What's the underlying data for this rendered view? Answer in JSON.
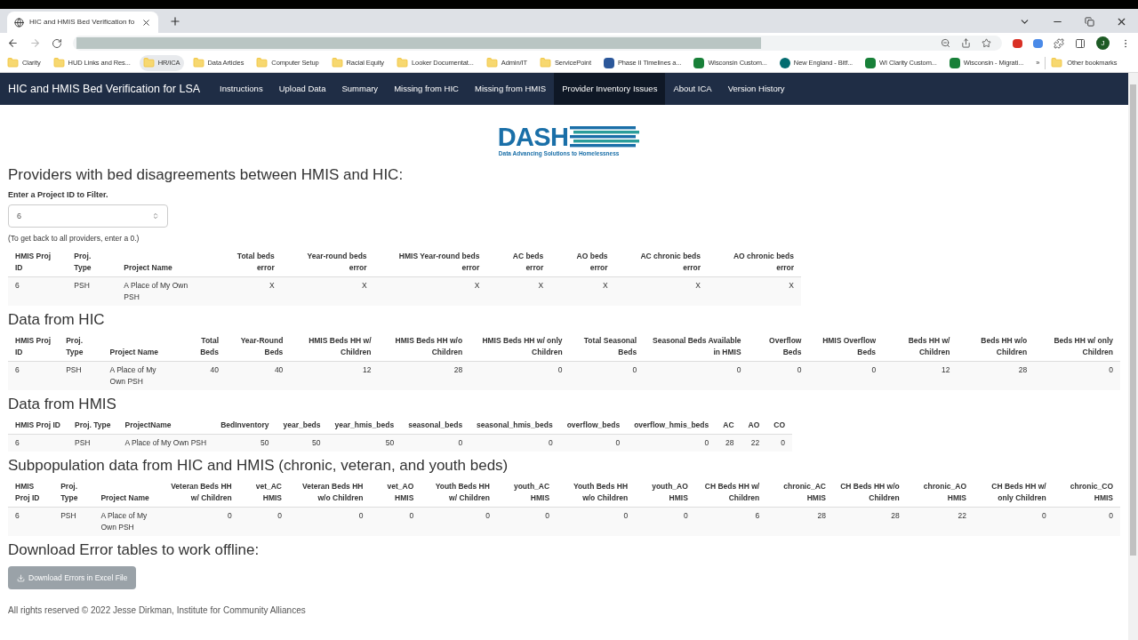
{
  "browser": {
    "tab_title": "HIC and HMIS Bed Verification fo",
    "profile_initial": "J",
    "bookmarks": [
      {
        "label": "Clarity",
        "kind": "folder",
        "hovered": false
      },
      {
        "label": "HUD Links and Res...",
        "kind": "folder",
        "hovered": false
      },
      {
        "label": "HR/ICA",
        "kind": "folder",
        "hovered": true
      },
      {
        "label": "Data Articles",
        "kind": "folder",
        "hovered": false
      },
      {
        "label": "Computer Setup",
        "kind": "folder",
        "hovered": false
      },
      {
        "label": "Racial Equity",
        "kind": "folder",
        "hovered": false
      },
      {
        "label": "Looker Documentat...",
        "kind": "folder",
        "hovered": false
      },
      {
        "label": "Admin/IT",
        "kind": "folder",
        "hovered": false
      },
      {
        "label": "ServicePoint",
        "kind": "folder",
        "hovered": false
      },
      {
        "label": "Phase II Timelines a...",
        "kind": "doc",
        "hovered": false
      },
      {
        "label": "Wisconsin Custom...",
        "kind": "sheet",
        "hovered": false
      },
      {
        "label": "New England - Bitf...",
        "kind": "site",
        "hovered": false
      },
      {
        "label": "WI Clarity Custom...",
        "kind": "sheet",
        "hovered": false
      },
      {
        "label": "Wisconsin - Migrati...",
        "kind": "sheet",
        "hovered": false
      }
    ],
    "more": "»",
    "other_bookmarks": "Other bookmarks"
  },
  "app": {
    "title": "HIC and HMIS Bed Verification for LSA",
    "nav": [
      {
        "label": "Instructions",
        "selected": false
      },
      {
        "label": "Upload Data",
        "selected": false
      },
      {
        "label": "Summary",
        "selected": false
      },
      {
        "label": "Missing from HIC",
        "selected": false
      },
      {
        "label": "Missing from HMIS",
        "selected": false
      },
      {
        "label": "Provider Inventory Issues",
        "selected": true
      },
      {
        "label": "About ICA",
        "selected": false
      },
      {
        "label": "Version History",
        "selected": false
      }
    ]
  },
  "logo": {
    "wordmark": "DASH",
    "tagline": "Data Advancing Solutions to Homelessness"
  },
  "heading": "Providers with bed disagreements between HMIS and HIC:",
  "filter": {
    "label": "Enter a Project ID to Filter.",
    "value": "6",
    "hint": "(To get back to all providers, enter a 0.)"
  },
  "tables": [
    {
      "columns": [
        "HMIS Proj ID",
        "Proj. Type",
        "Project Name",
        "Total beds error",
        "Year-round beds error",
        "HMIS Year-round beds error",
        "AC beds error",
        "AO beds error",
        "AC chronic beds error",
        "AO chronic beds error"
      ],
      "rows": [
        [
          "6",
          "PSH",
          "A Place of My Own PSH",
          "X",
          "X",
          "X",
          "X",
          "X",
          "X",
          "X"
        ]
      ]
    },
    {
      "title": "Data from HIC",
      "columns": [
        "HMIS Proj ID",
        "Proj. Type",
        "Project Name",
        "Total Beds",
        "Year-Round Beds",
        "HMIS Beds HH w/ Children",
        "HMIS Beds HH w/o Children",
        "HMIS Beds HH w/ only Children",
        "Total Seasonal Beds",
        "Seasonal Beds Available in HMIS",
        "Overflow Beds",
        "HMIS Overflow Beds",
        "Beds HH w/ Children",
        "Beds HH w/o Children",
        "Beds HH w/ only Children"
      ],
      "rows": [
        [
          "6",
          "PSH",
          "A Place of My Own PSH",
          "40",
          "40",
          "12",
          "28",
          "0",
          "0",
          "0",
          "0",
          "0",
          "12",
          "28",
          "0"
        ]
      ]
    },
    {
      "title": "Data from HMIS",
      "columns": [
        "HMIS Proj ID",
        "Proj. Type",
        "ProjectName",
        "BedInventory",
        "year_beds",
        "year_hmis_beds",
        "seasonal_beds",
        "seasonal_hmis_beds",
        "overflow_beds",
        "overflow_hmis_beds",
        "AC",
        "AO",
        "CO"
      ],
      "rows": [
        [
          "6",
          "PSH",
          "A Place of My Own PSH",
          "50",
          "50",
          "50",
          "0",
          "0",
          "0",
          "0",
          "28",
          "22",
          "0"
        ]
      ]
    },
    {
      "title": "Subpopulation data from HIC and HMIS (chronic, veteran, and youth beds)",
      "columns": [
        "HMIS Proj ID",
        "Proj. Type",
        "Project Name",
        "Veteran Beds HH w/ Children",
        "vet_AC HMIS",
        "Veteran Beds HH w/o Children",
        "vet_AO HMIS",
        "Youth Beds HH w/ Children",
        "youth_AC HMIS",
        "Youth Beds HH w/o Children",
        "youth_AO HMIS",
        "CH Beds HH w/ Children",
        "chronic_AC HMIS",
        "CH Beds HH w/o Children",
        "chronic_AO HMIS",
        "CH Beds HH w/ only Children",
        "chronic_CO HMIS"
      ],
      "rows": [
        [
          "6",
          "PSH",
          "A Place of My Own PSH",
          "0",
          "0",
          "0",
          "0",
          "0",
          "0",
          "0",
          "0",
          "6",
          "28",
          "28",
          "22",
          "0",
          "0"
        ]
      ]
    }
  ],
  "download": {
    "heading": "Download Error tables to work offline:",
    "button": "Download Errors in Excel File"
  },
  "footer": "All rights reserved © 2022 Jesse Dirkman, Institute for Community Alliances"
}
